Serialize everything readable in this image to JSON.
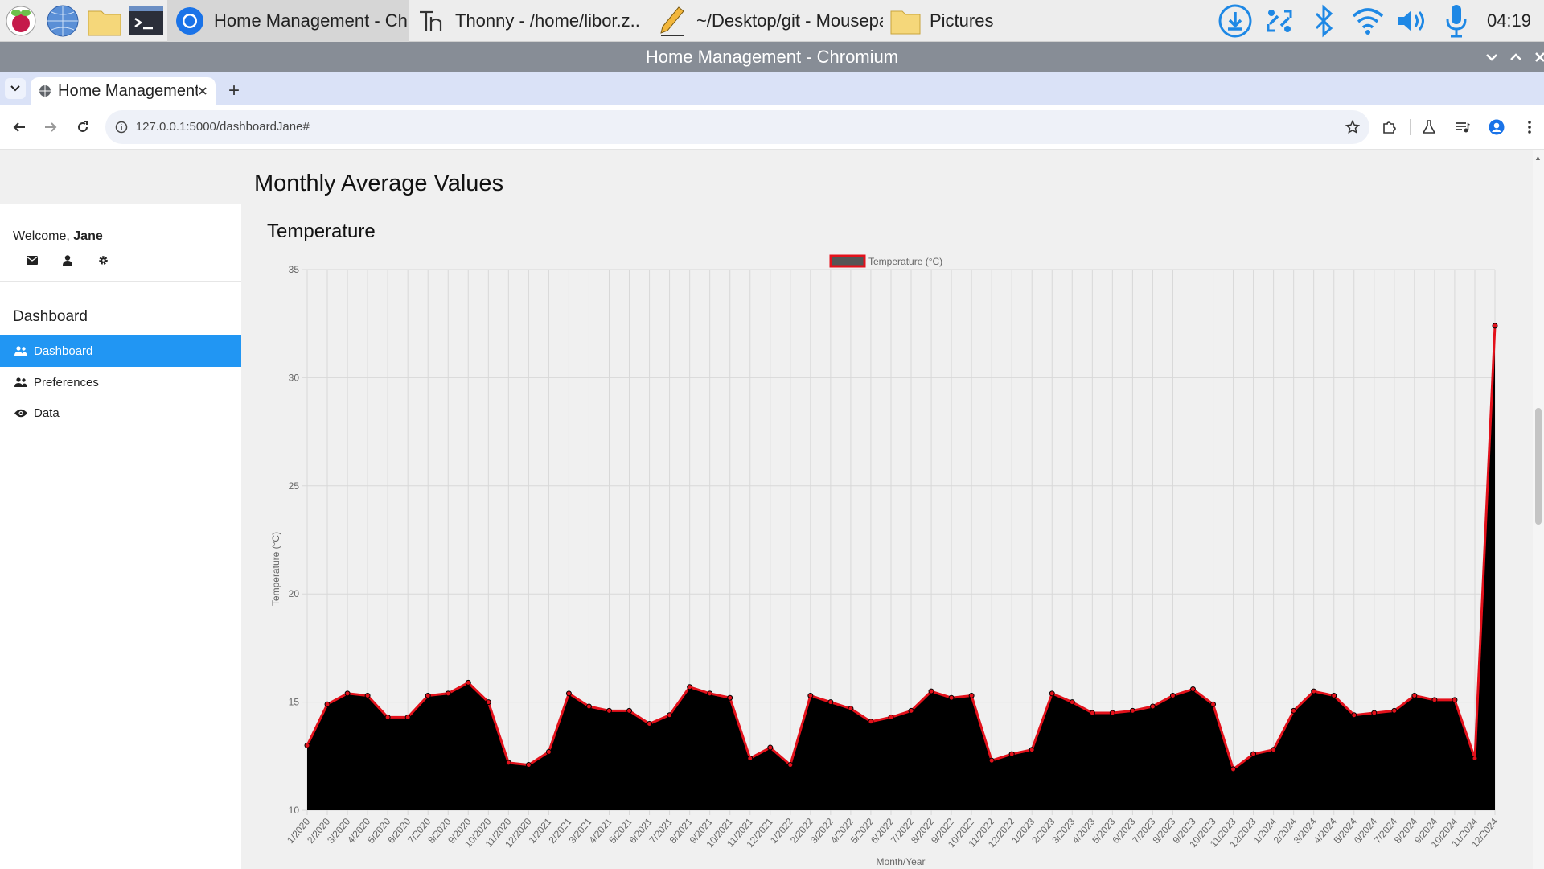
{
  "taskbar": {
    "tasks": [
      {
        "label": "Home Management - Ch..",
        "icon": "chromium-icon"
      },
      {
        "label": "Thonny  -  /home/libor.z..",
        "icon": "thonny-icon"
      },
      {
        "label": "~/Desktop/git - Mousepa..",
        "icon": "pencil-icon"
      },
      {
        "label": "Pictures",
        "icon": "folder-icon"
      }
    ],
    "clock": "04:19"
  },
  "window": {
    "title": "Home Management - Chromium"
  },
  "browser": {
    "tab_title": "Home Management",
    "url": "127.0.0.1:5000/dashboardJane#",
    "new_tab_label": "+"
  },
  "sidebar": {
    "welcome_prefix": "Welcome, ",
    "user_name": "Jane",
    "heading": "Dashboard",
    "items": [
      {
        "label": "Dashboard",
        "icon": "users-icon",
        "active": true
      },
      {
        "label": "Preferences",
        "icon": "users-icon",
        "active": false
      },
      {
        "label": "Data",
        "icon": "eye-icon",
        "active": false
      }
    ]
  },
  "main": {
    "page_title": "Monthly Average Values",
    "chart_title": "Temperature"
  },
  "colors": {
    "accent": "#2196f3",
    "line": "#e3111b",
    "fill": "#000000"
  },
  "chart_data": {
    "type": "area",
    "legend": "Temperature (°C)",
    "ylabel": "Temperature (°C)",
    "xlabel": "Month/Year",
    "ylim": [
      10,
      35
    ],
    "yticks": [
      10,
      15,
      20,
      25,
      30,
      35
    ],
    "legend_position": "top-center",
    "grid": true,
    "categories": [
      "1/2020",
      "2/2020",
      "3/2020",
      "4/2020",
      "5/2020",
      "6/2020",
      "7/2020",
      "8/2020",
      "9/2020",
      "10/2020",
      "11/2020",
      "12/2020",
      "1/2021",
      "2/2021",
      "3/2021",
      "4/2021",
      "5/2021",
      "6/2021",
      "7/2021",
      "8/2021",
      "9/2021",
      "10/2021",
      "11/2021",
      "12/2021",
      "1/2022",
      "2/2022",
      "3/2022",
      "4/2022",
      "5/2022",
      "6/2022",
      "7/2022",
      "8/2022",
      "9/2022",
      "10/2022",
      "11/2022",
      "12/2022",
      "1/2023",
      "2/2023",
      "3/2023",
      "4/2023",
      "5/2023",
      "6/2023",
      "7/2023",
      "8/2023",
      "9/2023",
      "10/2023",
      "11/2023",
      "12/2023",
      "1/2024",
      "2/2024",
      "3/2024",
      "4/2024",
      "5/2024",
      "6/2024",
      "7/2024",
      "8/2024",
      "9/2024",
      "10/2024",
      "11/2024",
      "12/2024"
    ],
    "values": [
      13.0,
      14.9,
      15.4,
      15.3,
      14.3,
      14.3,
      15.3,
      15.4,
      15.9,
      15.0,
      12.2,
      12.1,
      12.7,
      15.4,
      14.8,
      14.6,
      14.6,
      14.0,
      14.4,
      15.7,
      15.4,
      15.2,
      12.4,
      12.9,
      12.1,
      15.3,
      15.0,
      14.7,
      14.1,
      14.3,
      14.6,
      15.5,
      15.2,
      15.3,
      12.3,
      12.6,
      12.8,
      15.4,
      15.0,
      14.5,
      14.5,
      14.6,
      14.8,
      15.3,
      15.6,
      14.9,
      11.9,
      12.6,
      12.8,
      14.6,
      15.5,
      15.3,
      14.4,
      14.5,
      14.6,
      15.3,
      15.1,
      15.1,
      12.4,
      32.4
    ]
  }
}
